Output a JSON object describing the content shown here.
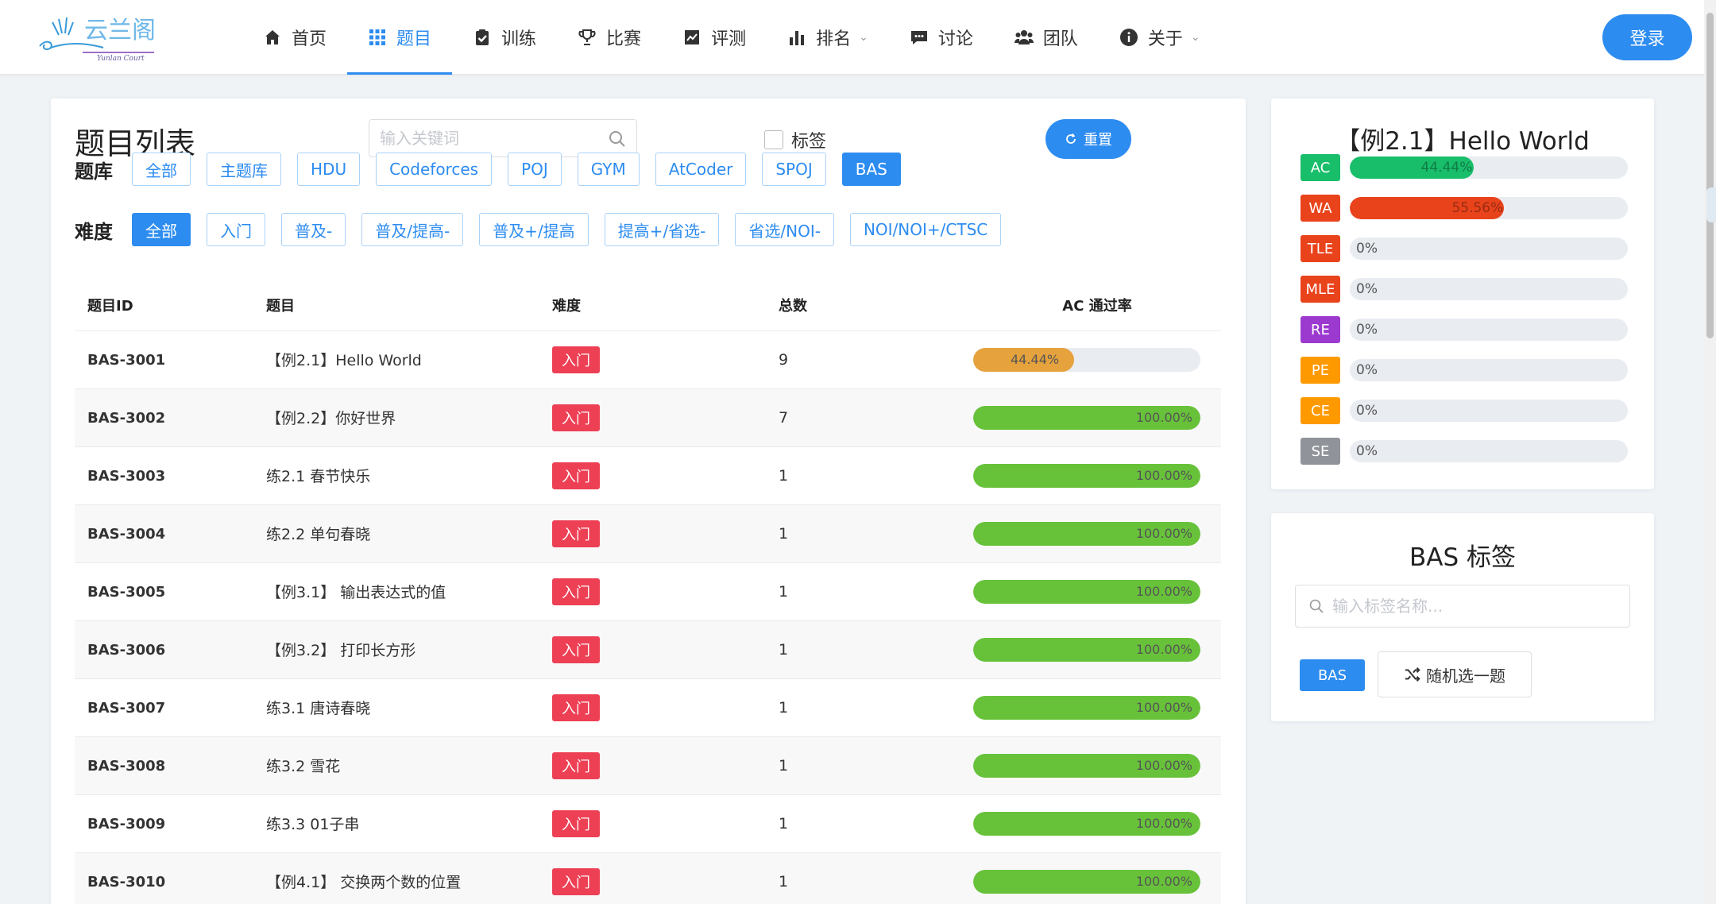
{
  "colors": {
    "primary": "#2d8cf0",
    "difficulty_tag": "#ed4055",
    "rate_green": "#67c23a",
    "rate_orange": "#e6a23c"
  },
  "nav": {
    "logo_text": "云兰阁",
    "logo_subtext": "Yunlan Court",
    "items": [
      {
        "label": "首页",
        "icon": "home-icon"
      },
      {
        "label": "题目",
        "icon": "grid-icon"
      },
      {
        "label": "训练",
        "icon": "clipboard-check-icon"
      },
      {
        "label": "比赛",
        "icon": "trophy-icon"
      },
      {
        "label": "评测",
        "icon": "line-chart-icon"
      },
      {
        "label": "排名",
        "icon": "bar-chart-icon"
      },
      {
        "label": "讨论",
        "icon": "comment-icon"
      },
      {
        "label": "团队",
        "icon": "users-icon"
      },
      {
        "label": "关于",
        "icon": "info-icon"
      }
    ],
    "login": "登录"
  },
  "problem_list": {
    "title": "题目列表",
    "search_placeholder": "输入关键词",
    "tag_checkbox_label": "标签",
    "reset_label": "重置",
    "bank_label": "题库",
    "banks": [
      "全部",
      "主题库",
      "HDU",
      "Codeforces",
      "POJ",
      "GYM",
      "AtCoder",
      "SPOJ",
      "BAS"
    ],
    "active_bank": "BAS",
    "difficulty_label": "难度",
    "difficulties": [
      "全部",
      "入门",
      "普及-",
      "普及/提高-",
      "普及+/提高",
      "提高+/省选-",
      "省选/NOI-",
      "NOI/NOI+/CTSC"
    ],
    "active_difficulty": "全部",
    "columns": [
      "题目ID",
      "题目",
      "难度",
      "总数",
      "AC 通过率"
    ],
    "rows": [
      {
        "id": "BAS-3001",
        "title": "【例2.1】Hello World",
        "difficulty": "入门",
        "total": "9",
        "rate": 44.44,
        "rate_label": "44.44%"
      },
      {
        "id": "BAS-3002",
        "title": "【例2.2】你好世界",
        "difficulty": "入门",
        "total": "7",
        "rate": 100,
        "rate_label": "100.00%"
      },
      {
        "id": "BAS-3003",
        "title": "练2.1 春节快乐",
        "difficulty": "入门",
        "total": "1",
        "rate": 100,
        "rate_label": "100.00%"
      },
      {
        "id": "BAS-3004",
        "title": "练2.2 单句春晓",
        "difficulty": "入门",
        "total": "1",
        "rate": 100,
        "rate_label": "100.00%"
      },
      {
        "id": "BAS-3005",
        "title": "【例3.1】 输出表达式的值",
        "difficulty": "入门",
        "total": "1",
        "rate": 100,
        "rate_label": "100.00%"
      },
      {
        "id": "BAS-3006",
        "title": "【例3.2】 打印长方形",
        "difficulty": "入门",
        "total": "1",
        "rate": 100,
        "rate_label": "100.00%"
      },
      {
        "id": "BAS-3007",
        "title": "练3.1 唐诗春晓",
        "difficulty": "入门",
        "total": "1",
        "rate": 100,
        "rate_label": "100.00%"
      },
      {
        "id": "BAS-3008",
        "title": "练3.2 雪花",
        "difficulty": "入门",
        "total": "1",
        "rate": 100,
        "rate_label": "100.00%"
      },
      {
        "id": "BAS-3009",
        "title": "练3.3 01子串",
        "difficulty": "入门",
        "total": "1",
        "rate": 100,
        "rate_label": "100.00%"
      },
      {
        "id": "BAS-3010",
        "title": "【例4.1】 交换两个数的位置",
        "difficulty": "入门",
        "total": "1",
        "rate": 100,
        "rate_label": "100.00%"
      }
    ]
  },
  "stats": {
    "title": "【例2.1】Hello World",
    "items": [
      {
        "label": "AC",
        "color": "#19be6b",
        "value": 44.44,
        "text": "44.44%"
      },
      {
        "label": "WA",
        "color": "#e9431b",
        "value": 55.56,
        "text": "55.56%"
      },
      {
        "label": "TLE",
        "color": "#e9431b",
        "value": 0,
        "text": "0%"
      },
      {
        "label": "MLE",
        "color": "#e9431b",
        "value": 0,
        "text": "0%"
      },
      {
        "label": "RE",
        "color": "#9c3ad0",
        "value": 0,
        "text": "0%"
      },
      {
        "label": "PE",
        "color": "#ff9900",
        "value": 0,
        "text": "0%"
      },
      {
        "label": "CE",
        "color": "#ff9900",
        "value": 0,
        "text": "0%"
      },
      {
        "label": "SE",
        "color": "#909399",
        "value": 0,
        "text": "0%"
      }
    ]
  },
  "tags": {
    "title": "BAS 标签",
    "search_placeholder": "输入标签名称...",
    "tag": "BAS",
    "random_label": "随机选一题"
  }
}
